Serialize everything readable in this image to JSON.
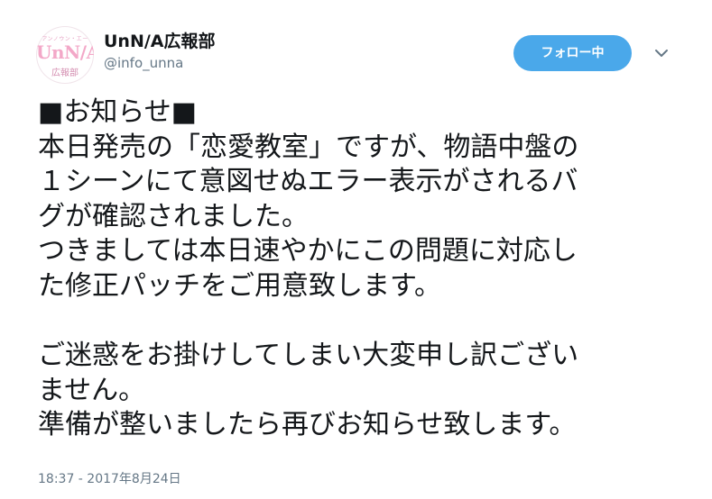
{
  "account": {
    "display_name": "UnN/A広報部",
    "handle": "@info_unna",
    "avatar": {
      "tagline": "アンノウン・エー",
      "logo": "UnN/A",
      "dept": "広報部"
    }
  },
  "follow_button": {
    "label": "フォロー中"
  },
  "tweet": {
    "lines": [
      "■お知らせ■",
      "本日発売の「恋愛教室」ですが、物語中盤の",
      "１シーンにて意図せぬエラー表示がされるバ",
      "グが確認されました。",
      "つきましては本日速やかにこの問題に対応し",
      "た修正パッチをご用意致します。",
      "",
      "ご迷惑をお掛けしてしまい大変申し訳ござい",
      "ません。",
      "準備が整いましたら再びお知らせ致します。"
    ],
    "timestamp": "18:37 - 2017年8月24日"
  },
  "icons": {
    "caret": "chevron-down-icon"
  },
  "colors": {
    "follow_button_bg": "#4aa8ea",
    "secondary_text": "#657786",
    "primary_text": "#14171a",
    "avatar_accent": "#f3a8c8"
  }
}
